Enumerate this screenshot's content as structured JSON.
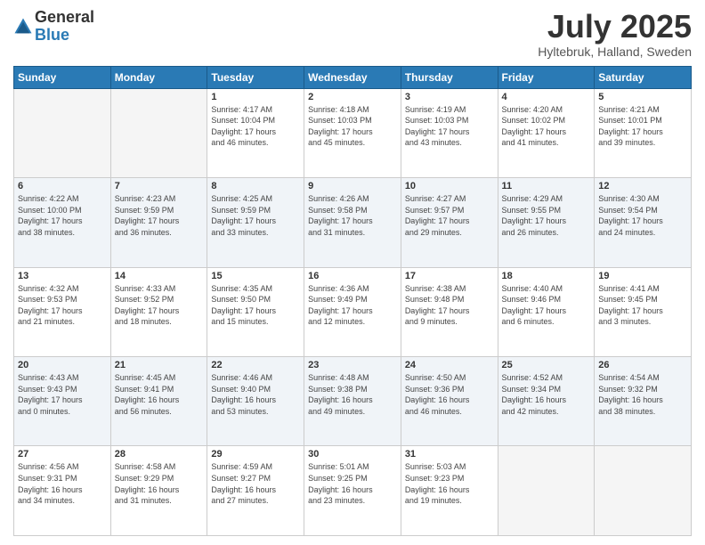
{
  "header": {
    "logo_general": "General",
    "logo_blue": "Blue",
    "month": "July 2025",
    "location": "Hyltebruk, Halland, Sweden"
  },
  "days_of_week": [
    "Sunday",
    "Monday",
    "Tuesday",
    "Wednesday",
    "Thursday",
    "Friday",
    "Saturday"
  ],
  "weeks": [
    [
      {
        "num": "",
        "info": ""
      },
      {
        "num": "",
        "info": ""
      },
      {
        "num": "1",
        "info": "Sunrise: 4:17 AM\nSunset: 10:04 PM\nDaylight: 17 hours\nand 46 minutes."
      },
      {
        "num": "2",
        "info": "Sunrise: 4:18 AM\nSunset: 10:03 PM\nDaylight: 17 hours\nand 45 minutes."
      },
      {
        "num": "3",
        "info": "Sunrise: 4:19 AM\nSunset: 10:03 PM\nDaylight: 17 hours\nand 43 minutes."
      },
      {
        "num": "4",
        "info": "Sunrise: 4:20 AM\nSunset: 10:02 PM\nDaylight: 17 hours\nand 41 minutes."
      },
      {
        "num": "5",
        "info": "Sunrise: 4:21 AM\nSunset: 10:01 PM\nDaylight: 17 hours\nand 39 minutes."
      }
    ],
    [
      {
        "num": "6",
        "info": "Sunrise: 4:22 AM\nSunset: 10:00 PM\nDaylight: 17 hours\nand 38 minutes."
      },
      {
        "num": "7",
        "info": "Sunrise: 4:23 AM\nSunset: 9:59 PM\nDaylight: 17 hours\nand 36 minutes."
      },
      {
        "num": "8",
        "info": "Sunrise: 4:25 AM\nSunset: 9:59 PM\nDaylight: 17 hours\nand 33 minutes."
      },
      {
        "num": "9",
        "info": "Sunrise: 4:26 AM\nSunset: 9:58 PM\nDaylight: 17 hours\nand 31 minutes."
      },
      {
        "num": "10",
        "info": "Sunrise: 4:27 AM\nSunset: 9:57 PM\nDaylight: 17 hours\nand 29 minutes."
      },
      {
        "num": "11",
        "info": "Sunrise: 4:29 AM\nSunset: 9:55 PM\nDaylight: 17 hours\nand 26 minutes."
      },
      {
        "num": "12",
        "info": "Sunrise: 4:30 AM\nSunset: 9:54 PM\nDaylight: 17 hours\nand 24 minutes."
      }
    ],
    [
      {
        "num": "13",
        "info": "Sunrise: 4:32 AM\nSunset: 9:53 PM\nDaylight: 17 hours\nand 21 minutes."
      },
      {
        "num": "14",
        "info": "Sunrise: 4:33 AM\nSunset: 9:52 PM\nDaylight: 17 hours\nand 18 minutes."
      },
      {
        "num": "15",
        "info": "Sunrise: 4:35 AM\nSunset: 9:50 PM\nDaylight: 17 hours\nand 15 minutes."
      },
      {
        "num": "16",
        "info": "Sunrise: 4:36 AM\nSunset: 9:49 PM\nDaylight: 17 hours\nand 12 minutes."
      },
      {
        "num": "17",
        "info": "Sunrise: 4:38 AM\nSunset: 9:48 PM\nDaylight: 17 hours\nand 9 minutes."
      },
      {
        "num": "18",
        "info": "Sunrise: 4:40 AM\nSunset: 9:46 PM\nDaylight: 17 hours\nand 6 minutes."
      },
      {
        "num": "19",
        "info": "Sunrise: 4:41 AM\nSunset: 9:45 PM\nDaylight: 17 hours\nand 3 minutes."
      }
    ],
    [
      {
        "num": "20",
        "info": "Sunrise: 4:43 AM\nSunset: 9:43 PM\nDaylight: 17 hours\nand 0 minutes."
      },
      {
        "num": "21",
        "info": "Sunrise: 4:45 AM\nSunset: 9:41 PM\nDaylight: 16 hours\nand 56 minutes."
      },
      {
        "num": "22",
        "info": "Sunrise: 4:46 AM\nSunset: 9:40 PM\nDaylight: 16 hours\nand 53 minutes."
      },
      {
        "num": "23",
        "info": "Sunrise: 4:48 AM\nSunset: 9:38 PM\nDaylight: 16 hours\nand 49 minutes."
      },
      {
        "num": "24",
        "info": "Sunrise: 4:50 AM\nSunset: 9:36 PM\nDaylight: 16 hours\nand 46 minutes."
      },
      {
        "num": "25",
        "info": "Sunrise: 4:52 AM\nSunset: 9:34 PM\nDaylight: 16 hours\nand 42 minutes."
      },
      {
        "num": "26",
        "info": "Sunrise: 4:54 AM\nSunset: 9:32 PM\nDaylight: 16 hours\nand 38 minutes."
      }
    ],
    [
      {
        "num": "27",
        "info": "Sunrise: 4:56 AM\nSunset: 9:31 PM\nDaylight: 16 hours\nand 34 minutes."
      },
      {
        "num": "28",
        "info": "Sunrise: 4:58 AM\nSunset: 9:29 PM\nDaylight: 16 hours\nand 31 minutes."
      },
      {
        "num": "29",
        "info": "Sunrise: 4:59 AM\nSunset: 9:27 PM\nDaylight: 16 hours\nand 27 minutes."
      },
      {
        "num": "30",
        "info": "Sunrise: 5:01 AM\nSunset: 9:25 PM\nDaylight: 16 hours\nand 23 minutes."
      },
      {
        "num": "31",
        "info": "Sunrise: 5:03 AM\nSunset: 9:23 PM\nDaylight: 16 hours\nand 19 minutes."
      },
      {
        "num": "",
        "info": ""
      },
      {
        "num": "",
        "info": ""
      }
    ]
  ]
}
